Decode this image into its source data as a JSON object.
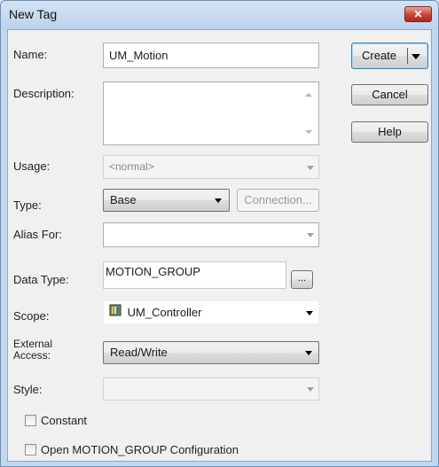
{
  "window": {
    "title": "New Tag",
    "close_glyph": "✕"
  },
  "fields": {
    "name_label": "Name:",
    "name_value": "UM_Motion",
    "description_label": "Description:",
    "description_value": "",
    "usage_label": "Usage:",
    "usage_value": "<normal>",
    "type_label": "Type:",
    "type_value": "Base",
    "connection_label": "Connection...",
    "alias_label": "Alias For:",
    "alias_value": "",
    "data_type_label": "Data Type:",
    "data_type_value": "MOTION_GROUP",
    "browse_label": "...",
    "scope_label": "Scope:",
    "scope_value": "UM_Controller",
    "scope_icon": "controller-icon",
    "external_access_label_line1": "External",
    "external_access_label_line2": "Access:",
    "external_access_value": "Read/Write",
    "style_label": "Style:",
    "style_value": ""
  },
  "buttons": {
    "create": "Create",
    "cancel": "Cancel",
    "help": "Help"
  },
  "checkboxes": {
    "constant_label": "Constant",
    "constant_checked": false,
    "open_config_label": "Open MOTION_GROUP Configuration",
    "open_config_checked": false
  },
  "colors": {
    "accent": "#3c7fb1",
    "close": "#c9443a"
  }
}
